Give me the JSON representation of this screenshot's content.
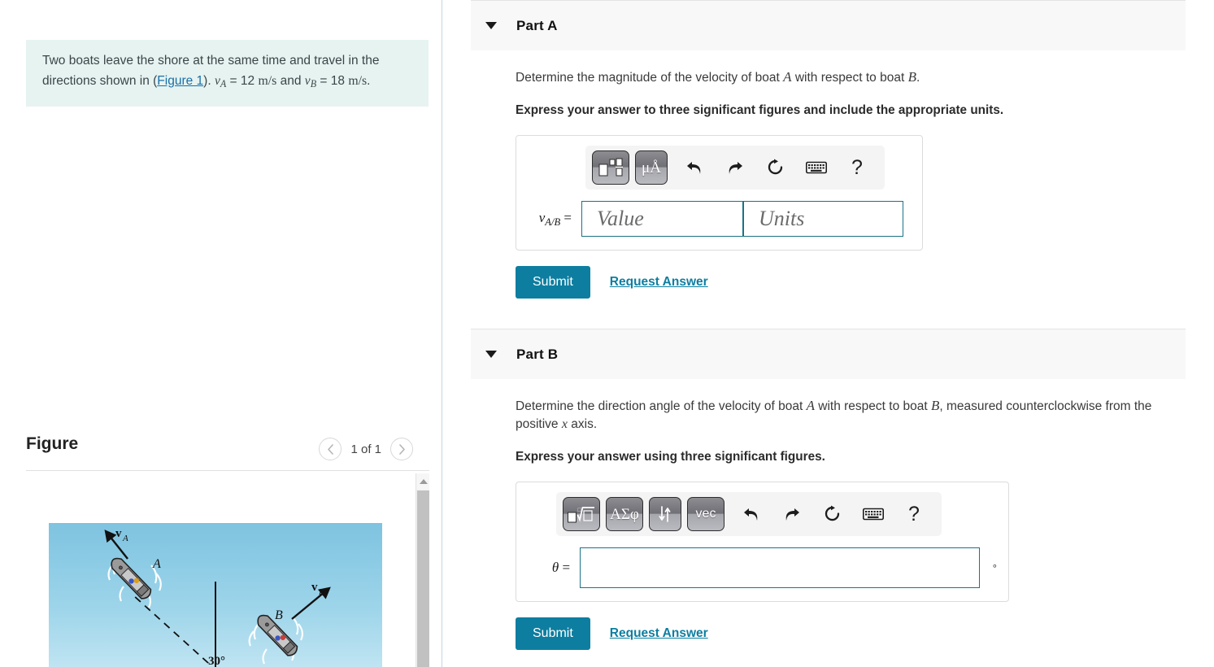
{
  "problem": {
    "line1": "Two boats leave the shore at the same time and travel in",
    "line2_pre": "the directions shown in (",
    "figure_link": "Figure 1",
    "line2_post": ").",
    "v_a_label": "v",
    "v_a_sub": "A",
    "v_a_value": "= 12",
    "v_a_units": "m/s",
    "and": "and",
    "v_b_label": "v",
    "v_b_sub": "B",
    "v_b_value": "= 18",
    "v_b_units": "m/s",
    "period": "."
  },
  "figure": {
    "title": "Figure",
    "prev_icon": "chevron-left-icon",
    "next_icon": "chevron-right-icon",
    "counter": "1 of 1",
    "boat_a_label": "A",
    "boat_b_label": "B",
    "vector_a_label": "v",
    "vector_a_sub": "A",
    "vector_b_label": "v",
    "vector_b_sub": "B",
    "angle_label": "30°",
    "sky_color": "#8fcfe8",
    "water_color": "#7ec8e3"
  },
  "parts": [
    {
      "id": "part-a",
      "label": "Part A",
      "caret_icon": "caret-down-icon",
      "question_pre": "Determine the magnitude of the velocity of boat ",
      "question_var1": "A",
      "question_mid": " with respect to boat ",
      "question_var2": "B",
      "question_post": ".",
      "instruction": "Express your answer to three significant figures and include the appropriate units.",
      "toolbar": [
        {
          "name": "template-palette-button",
          "glyph": ""
        },
        {
          "name": "units-palette-button",
          "glyph": "μÅ"
        }
      ],
      "icons": [
        {
          "name": "undo-icon",
          "title": "undo"
        },
        {
          "name": "redo-icon",
          "title": "redo"
        },
        {
          "name": "reset-icon",
          "title": "reset"
        },
        {
          "name": "keyboard-icon",
          "title": "keyboard"
        },
        {
          "name": "help-icon",
          "title": "help",
          "glyph": "?"
        }
      ],
      "var_label": "v",
      "var_sub": "A/B",
      "equals": "=",
      "value_placeholder": "Value",
      "units_placeholder": "Units",
      "submit_label": "Submit",
      "request_label": "Request Answer"
    },
    {
      "id": "part-b",
      "label": "Part B",
      "caret_icon": "caret-down-icon",
      "question_pre": "Determine the direction angle of the velocity of boat ",
      "question_var1": "A",
      "question_mid": " with respect to boat ",
      "question_var2": "B",
      "question_post": ", measured counterclockwise from the positive ",
      "question_var3": "x",
      "question_end": " axis.",
      "instruction": "Express your answer using three significant figures.",
      "toolbar": [
        {
          "name": "radical-template-button",
          "glyph": ""
        },
        {
          "name": "greek-symbols-button",
          "glyph": "ΑΣφ"
        },
        {
          "name": "arrows-button",
          "glyph": "⇅"
        },
        {
          "name": "vector-button",
          "glyph": "vec"
        }
      ],
      "icons": [
        {
          "name": "undo-icon",
          "title": "undo"
        },
        {
          "name": "redo-icon",
          "title": "redo"
        },
        {
          "name": "reset-icon",
          "title": "reset"
        },
        {
          "name": "keyboard-icon",
          "title": "keyboard"
        },
        {
          "name": "help-icon",
          "title": "help",
          "glyph": "?"
        }
      ],
      "var_label": "θ",
      "equals": "=",
      "theta_value": "",
      "degree_symbol": "°",
      "submit_label": "Submit",
      "request_label": "Request Answer"
    }
  ],
  "colors": {
    "accent": "#0d7ea0",
    "field_border": "#1a7287",
    "problem_bg": "#e6f3f1",
    "part_header_bg": "#f8f8f8"
  }
}
